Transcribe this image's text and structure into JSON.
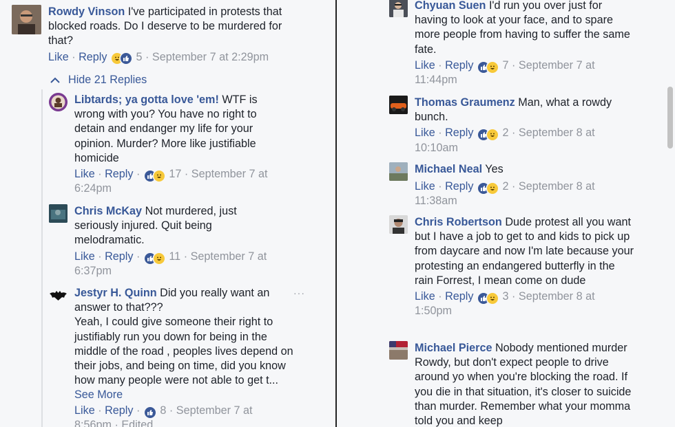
{
  "left": {
    "main_comment": {
      "author": "Rowdy Vinson",
      "text": "I've participated in protests that blocked roads. Do I deserve to be murdered for that?",
      "like": "Like",
      "reply": "Reply",
      "reaction_count": "5",
      "timestamp": "September 7 at 2:29pm"
    },
    "hide_replies": "Hide 21 Replies",
    "replies": [
      {
        "author": "Libtards; ya gotta love 'em!",
        "text": "WTF is wrong with you? You have no right to detain and endanger my life for your opinion. Murder? More like justifiable homicide",
        "like": "Like",
        "reply": "Reply",
        "reaction_count": "17",
        "timestamp": "September 7 at 6:24pm"
      },
      {
        "author": "Chris McKay",
        "text": "Not murdered, just seriously injured. Quit being melodramatic.",
        "like": "Like",
        "reply": "Reply",
        "reaction_count": "11",
        "timestamp": "September 7 at 6:37pm"
      },
      {
        "author": "Jestyr H. Quinn",
        "text": "Did you really want an answer to that???",
        "text2": "Yeah, I could give someone their right to justifiably run you down for being in the middle of the road , peoples lives depend on their jobs, and being on time, did you know how many people were not able to get t...",
        "see_more": "See More",
        "like": "Like",
        "reply": "Reply",
        "reaction_count": "8",
        "timestamp": "September 7 at",
        "timestamp_tail": "8:56pm · Edited"
      }
    ],
    "more_options": "···"
  },
  "right": {
    "replies": [
      {
        "author": "Chyuan Suen",
        "text": "I'd run you over just for having to look at your face, and to spare more people from having to suffer the same fate.",
        "like": "Like",
        "reply": "Reply",
        "reaction_count": "7",
        "timestamp": "September 7 at 11:44pm"
      },
      {
        "author": "Thomas Graumenz",
        "text": "Man, what a rowdy bunch.",
        "like": "Like",
        "reply": "Reply",
        "reaction_count": "2",
        "timestamp": "September 8 at 10:10am"
      },
      {
        "author": "Michael Neal",
        "text": "Yes",
        "like": "Like",
        "reply": "Reply",
        "reaction_count": "2",
        "timestamp": "September 8 at 11:38am"
      },
      {
        "author": "Chris Robertson",
        "text": "Dude protest all you want but I have a job to get to and kids to pick up from daycare and now I'm late because your protesting an endangered butterfly in the rain Forrest, I mean come on dude",
        "like": "Like",
        "reply": "Reply",
        "reaction_count": "3",
        "timestamp": "September 8 at 1:50pm"
      },
      {
        "author": "Michael Pierce",
        "text": "Nobody mentioned murder Rowdy, but don't expect people to drive around yo when you're blocking the road. If you die in that situation, it's closer to suicide than murder. Remember what your momma told you and keep"
      }
    ]
  },
  "icons": {
    "like": "thumbs-up-icon",
    "haha": "haha-face-icon",
    "chevron": "chevron-up-icon"
  },
  "colors": {
    "link": "#385898",
    "meta": "#90949c",
    "like_blue": "#3b5998",
    "haha_yellow": "#f7c93a"
  }
}
